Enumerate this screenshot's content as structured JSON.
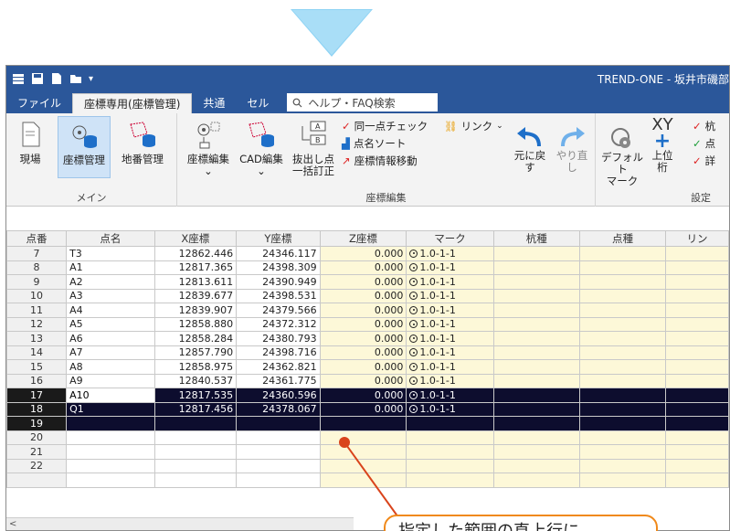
{
  "window": {
    "title": "TREND-ONE - 坂井市磯部"
  },
  "tabs": [
    {
      "label": "ファイル"
    },
    {
      "label": "座標専用(座標管理)"
    },
    {
      "label": "共通"
    },
    {
      "label": "セル"
    }
  ],
  "help": {
    "label": "ヘルプ・FAQ検索",
    "icon": "search-icon"
  },
  "ribbon": {
    "main_group": {
      "label": "メイン",
      "buttons": [
        "現場",
        "座標管理",
        "地番管理"
      ]
    },
    "edit_group": {
      "label": "座標編集",
      "buttons": [
        {
          "line1": "座標編集",
          "line2": "⌄"
        },
        {
          "line1": "CAD編集",
          "line2": "⌄"
        },
        {
          "line1": "抜出し点",
          "line2": "一括訂正"
        }
      ],
      "small_buttons": [
        "同一点チェック",
        "点名ソート",
        "座標情報移動",
        "リンク"
      ]
    },
    "undo": {
      "undo_label": "元に戻す",
      "redo_label": "やり直し"
    },
    "settings_group": {
      "label": "設定",
      "default_mark_line1": "デフォルト",
      "default_mark_line2": "マーク",
      "upper_digit_label": "上位桁",
      "xy_glyph": "XY",
      "right_items": [
        "杭",
        "点",
        "詳"
      ]
    }
  },
  "table": {
    "headers": [
      "点番",
      "点名",
      "X座標",
      "Y座標",
      "Z座標",
      "マーク",
      "杭種",
      "点種",
      "リン"
    ],
    "rows": [
      {
        "no": "7",
        "name": "T3",
        "x": "12862.446",
        "y": "24346.117",
        "z": "0.000",
        "mark": "1.0-1-1"
      },
      {
        "no": "8",
        "name": "A1",
        "x": "12817.365",
        "y": "24398.309",
        "z": "0.000",
        "mark": "1.0-1-1"
      },
      {
        "no": "9",
        "name": "A2",
        "x": "12813.611",
        "y": "24390.949",
        "z": "0.000",
        "mark": "1.0-1-1"
      },
      {
        "no": "10",
        "name": "A3",
        "x": "12839.677",
        "y": "24398.531",
        "z": "0.000",
        "mark": "1.0-1-1"
      },
      {
        "no": "11",
        "name": "A4",
        "x": "12839.907",
        "y": "24379.566",
        "z": "0.000",
        "mark": "1.0-1-1"
      },
      {
        "no": "12",
        "name": "A5",
        "x": "12858.880",
        "y": "24372.312",
        "z": "0.000",
        "mark": "1.0-1-1"
      },
      {
        "no": "13",
        "name": "A6",
        "x": "12858.284",
        "y": "24380.793",
        "z": "0.000",
        "mark": "1.0-1-1"
      },
      {
        "no": "14",
        "name": "A7",
        "x": "12857.790",
        "y": "24398.716",
        "z": "0.000",
        "mark": "1.0-1-1"
      },
      {
        "no": "15",
        "name": "A8",
        "x": "12858.975",
        "y": "24362.821",
        "z": "0.000",
        "mark": "1.0-1-1"
      },
      {
        "no": "16",
        "name": "A9",
        "x": "12840.537",
        "y": "24361.775",
        "z": "0.000",
        "mark": "1.0-1-1"
      },
      {
        "no": "17",
        "name": "A10",
        "x": "12817.535",
        "y": "24360.596",
        "z": "0.000",
        "mark": "1.0-1-1"
      },
      {
        "no": "18",
        "name": "Q1",
        "x": "12817.456",
        "y": "24378.067",
        "z": "0.000",
        "mark": "1.0-1-1"
      },
      {
        "no": "19",
        "name": "",
        "x": "",
        "y": "",
        "z": "",
        "mark": ""
      },
      {
        "no": "20",
        "name": "",
        "x": "",
        "y": "",
        "z": "",
        "mark": ""
      },
      {
        "no": "21",
        "name": "",
        "x": "",
        "y": "",
        "z": "",
        "mark": ""
      },
      {
        "no": "22",
        "name": "",
        "x": "",
        "y": "",
        "z": "",
        "mark": ""
      },
      {
        "no": "",
        "name": "",
        "x": "",
        "y": "",
        "z": "",
        "mark": ""
      }
    ],
    "selected_rows": [
      "17",
      "18",
      "19"
    ],
    "editing_row": "17"
  },
  "scrollbar": {
    "left_arrow": "<"
  },
  "callout": {
    "text": "指定した範囲の直上行に"
  },
  "colors": {
    "title_bar": "#2b579a",
    "pointer_triangle": "#a9def7",
    "selection": "#0d0d2e",
    "yellow_cells": "#fdf8d8",
    "callout_border": "#f0891a",
    "leader_line": "#d9441c"
  }
}
